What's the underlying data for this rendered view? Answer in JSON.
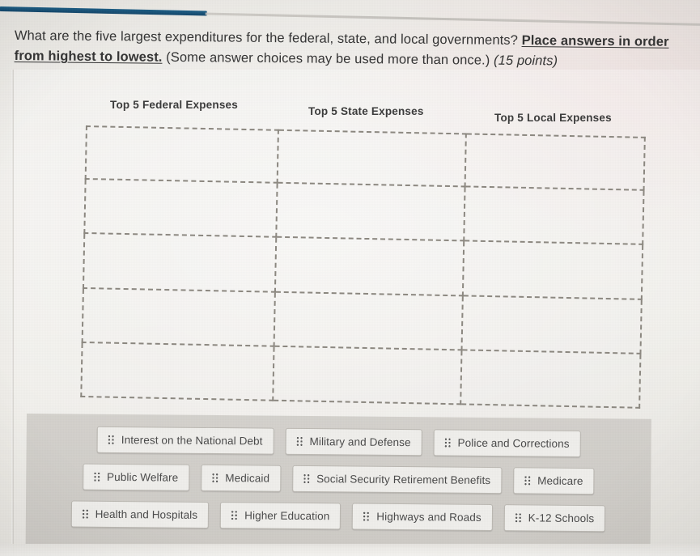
{
  "header": {
    "progress_bar_color": "#14476b",
    "rule_color": "#c6c3be"
  },
  "question": {
    "part1": "What are the five largest expenditures for the federal, state, and local governments? ",
    "emphasis": "Place answers in order from highest to lowest.",
    "part2": " (Some answer choices may be used more than once.) ",
    "points": "(15 points)"
  },
  "columns": [
    {
      "id": "federal",
      "heading": "Top 5 Federal Expenses"
    },
    {
      "id": "state",
      "heading": "Top 5 State Expenses"
    },
    {
      "id": "local",
      "heading": "Top 5 Local Expenses"
    }
  ],
  "grid": {
    "rows": 5,
    "cols": 3,
    "cells": [
      [
        "",
        "",
        ""
      ],
      [
        "",
        "",
        ""
      ],
      [
        "",
        "",
        ""
      ],
      [
        "",
        "",
        ""
      ],
      [
        "",
        "",
        ""
      ]
    ]
  },
  "answer_bank": {
    "handle_icon": "drag-handle-icon",
    "rows": [
      [
        "Interest on the National Debt",
        "Military and Defense",
        "Police and Corrections"
      ],
      [
        "Public Welfare",
        "Medicaid",
        "Social Security Retirement Benefits",
        "Medicare"
      ],
      [
        "Health and Hospitals",
        "Higher Education",
        "Highways and Roads",
        "K-12 Schools"
      ]
    ]
  }
}
